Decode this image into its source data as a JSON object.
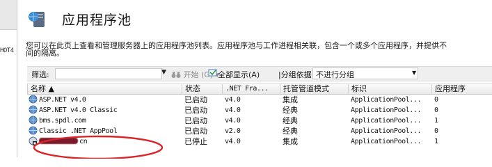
{
  "left_pane": {
    "node_label": "HOT4"
  },
  "header": {
    "title": "应用程序池",
    "icon": "application-pool-icon"
  },
  "description": {
    "line1": "您可以在此页上查看和管理服务器上的应用程序池列表。应用程序池与工作进程相关联，包含一个或多个应用程序，并提供不",
    "line2": "间的隔离。"
  },
  "filterbar": {
    "filter_label": "筛选:",
    "filter_value": "",
    "start_label": "开始 (G)",
    "show_all_label": "全部显示(A)",
    "group_by_label": "|分组依据:",
    "group_by_value": "不进行分组"
  },
  "columns": [
    "名称 ▲",
    "状态",
    ".NET Fra...",
    "托管管道模式",
    "标识",
    "应用程序"
  ],
  "rows": [
    {
      "name": "ASP.NET v4.0",
      "status": "已启动",
      "net": "v4.0",
      "mode": "集成",
      "identity": "ApplicationPool...",
      "apps": "0",
      "icon": "app-pool-running-icon"
    },
    {
      "name": "ASP.NET v4.0 Classic",
      "status": "已启动",
      "net": "v4.0",
      "mode": "经典",
      "identity": "ApplicationPool...",
      "apps": "0",
      "icon": "app-pool-running-icon"
    },
    {
      "name": "bms.spdl.com",
      "status": "已启动",
      "net": "v4.0",
      "mode": "经典",
      "identity": "ApplicationPool...",
      "apps": "1",
      "icon": "app-pool-running-icon"
    },
    {
      "name": "Classic .NET AppPool",
      "status": "已启动",
      "net": "v2.0",
      "mode": "经典",
      "identity": "ApplicationPool...",
      "apps": "0",
      "icon": "app-pool-running-icon"
    },
    {
      "name": "cn",
      "status": "已停止",
      "net": "v4.0",
      "mode": "集成",
      "identity": "ApplicationPool...",
      "apps": "1",
      "icon": "app-pool-stopped-icon",
      "redacted": true
    }
  ],
  "colors": {
    "annotation": "#d9262b",
    "redaction": "#7a1a2a"
  }
}
